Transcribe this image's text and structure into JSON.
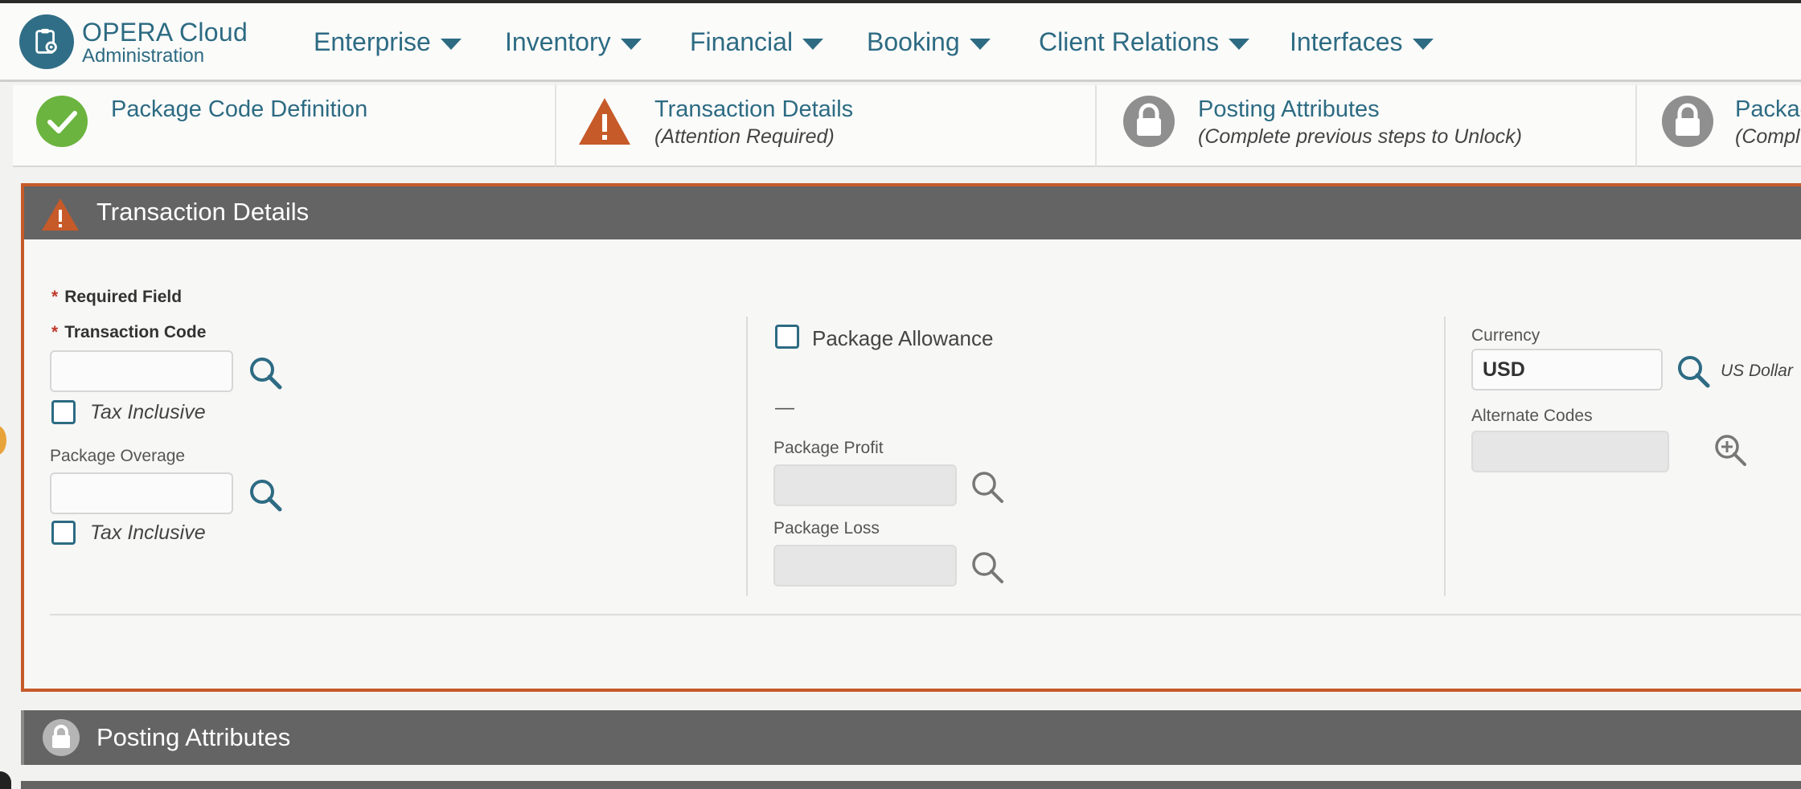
{
  "header": {
    "brand_title": "OPERA Cloud",
    "brand_sub": "Administration",
    "nav": [
      {
        "label": "Enterprise"
      },
      {
        "label": "Inventory"
      },
      {
        "label": "Financial"
      },
      {
        "label": "Booking"
      },
      {
        "label": "Client Relations"
      },
      {
        "label": "Interfaces"
      }
    ]
  },
  "steps": [
    {
      "title": "Package Code Definition",
      "subtitle": "",
      "status": "complete",
      "icon": "check-circle-icon"
    },
    {
      "title": "Transaction Details",
      "subtitle": "(Attention Required)",
      "status": "attention",
      "icon": "warning-icon"
    },
    {
      "title": "Posting Attributes",
      "subtitle": "(Complete previous steps to Unlock)",
      "status": "locked",
      "icon": "lock-icon"
    },
    {
      "title": "Packag",
      "subtitle": "(Compl",
      "status": "locked",
      "icon": "lock-icon"
    }
  ],
  "transaction_panel": {
    "title": "Transaction Details",
    "required_field_label": "Required Field",
    "transaction_code": {
      "label": "Transaction Code",
      "value": ""
    },
    "tax_inclusive_1": {
      "label": "Tax Inclusive",
      "checked": false
    },
    "package_overage": {
      "label": "Package Overage",
      "value": ""
    },
    "tax_inclusive_2": {
      "label": "Tax Inclusive",
      "checked": false
    },
    "package_allowance": {
      "label": "Package Allowance",
      "checked": false
    },
    "dash": "—",
    "package_profit": {
      "label": "Package Profit",
      "value": ""
    },
    "package_loss": {
      "label": "Package Loss",
      "value": ""
    },
    "currency": {
      "label": "Currency",
      "value": "USD",
      "description": "US Dollar"
    },
    "alternate_codes": {
      "label": "Alternate Codes",
      "value": ""
    }
  },
  "posting_panel": {
    "title": "Posting Attributes"
  },
  "colors": {
    "accent": "#2d6b83",
    "warning": "#c65a29",
    "success": "#6bb43f",
    "panel_header": "#646464"
  }
}
